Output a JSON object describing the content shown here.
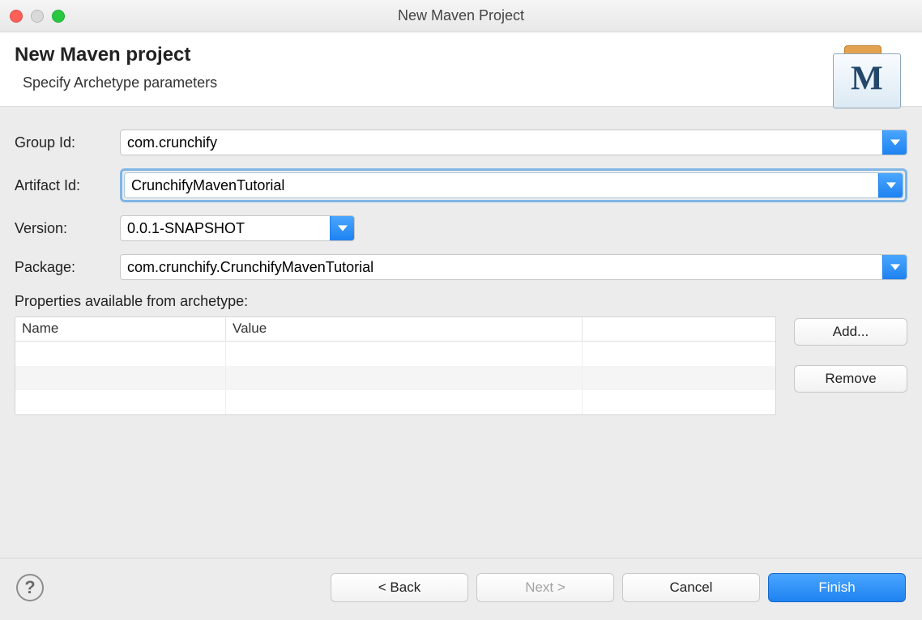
{
  "window": {
    "title": "New Maven Project"
  },
  "header": {
    "title": "New Maven project",
    "subtitle": "Specify Archetype parameters"
  },
  "form": {
    "group_label": "Group Id:",
    "group_value": "com.crunchify",
    "artifact_label": "Artifact Id:",
    "artifact_value": "CrunchifyMavenTutorial",
    "version_label": "Version:",
    "version_value": "0.0.1-SNAPSHOT",
    "package_label": "Package:",
    "package_value": "com.crunchify.CrunchifyMavenTutorial",
    "props_label": "Properties available from archetype:",
    "table": {
      "col_name": "Name",
      "col_value": "Value",
      "rows": []
    },
    "add_btn": "Add...",
    "remove_btn": "Remove"
  },
  "footer": {
    "back": "< Back",
    "next": "Next >",
    "cancel": "Cancel",
    "finish": "Finish"
  }
}
